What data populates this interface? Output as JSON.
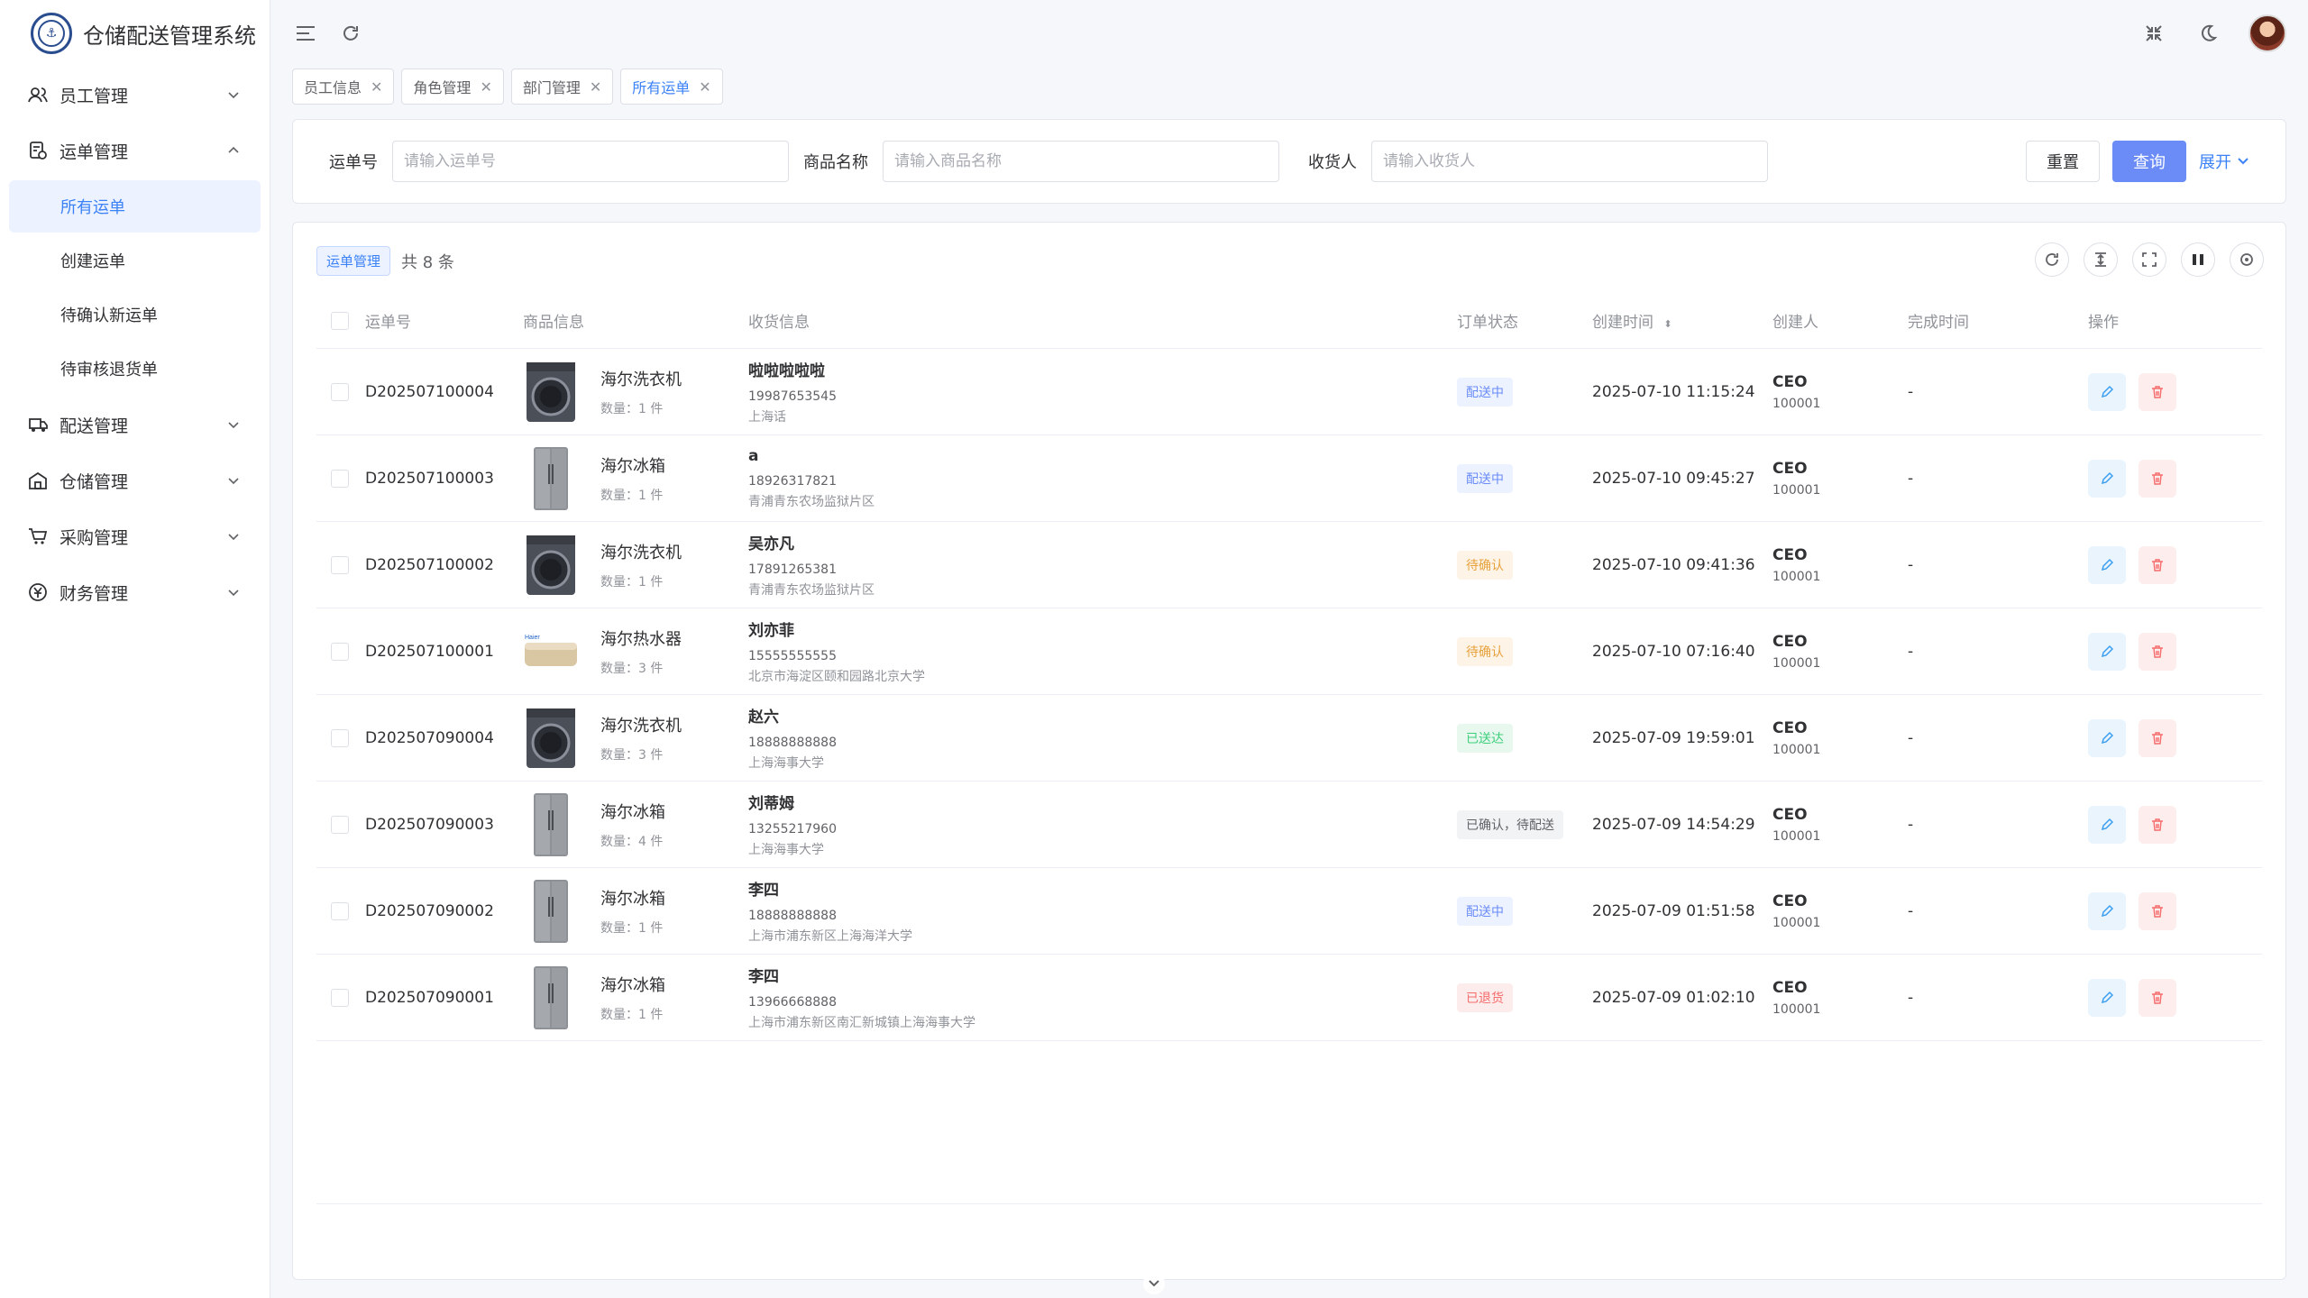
{
  "app": {
    "title": "仓储配送管理系统"
  },
  "sidebar": {
    "items": [
      {
        "label": "员工管理",
        "icon": "users-icon",
        "expanded": false
      },
      {
        "label": "运单管理",
        "icon": "waybill-icon",
        "expanded": true,
        "children": [
          {
            "label": "所有运单",
            "active": true
          },
          {
            "label": "创建运单"
          },
          {
            "label": "待确认新运单"
          },
          {
            "label": "待审核退货单"
          }
        ]
      },
      {
        "label": "配送管理",
        "icon": "truck-icon",
        "expanded": false
      },
      {
        "label": "仓储管理",
        "icon": "warehouse-icon",
        "expanded": false
      },
      {
        "label": "采购管理",
        "icon": "cart-icon",
        "expanded": false
      },
      {
        "label": "财务管理",
        "icon": "finance-icon",
        "expanded": false
      }
    ]
  },
  "tabs": [
    {
      "label": "员工信息",
      "active": false
    },
    {
      "label": "角色管理",
      "active": false
    },
    {
      "label": "部门管理",
      "active": false
    },
    {
      "label": "所有运单",
      "active": true
    }
  ],
  "search": {
    "waybill_label": "运单号",
    "waybill_placeholder": "请输入运单号",
    "goods_label": "商品名称",
    "goods_placeholder": "请输入商品名称",
    "receiver_label": "收货人",
    "receiver_placeholder": "请输入收货人",
    "reset": "重置",
    "query": "查询",
    "expand": "展开"
  },
  "table": {
    "tag": "运单管理",
    "total": "共 8 条",
    "columns": [
      "运单号",
      "商品信息",
      "收货信息",
      "订单状态",
      "创建时间",
      "创建人",
      "完成时间",
      "操作"
    ],
    "rows": [
      {
        "no": "D202507100004",
        "goods": "海尔洗衣机",
        "qty": "数量：1 件",
        "img": "washer",
        "rname": "啦啦啦啦啦",
        "rphone": "19987653545",
        "raddr": "上海话",
        "status": "配送中",
        "status_color": "blue",
        "time": "2025-07-10 11:15:24",
        "creator": "CEO",
        "creator_id": "100001",
        "done": "-"
      },
      {
        "no": "D202507100003",
        "goods": "海尔冰箱",
        "qty": "数量：1 件",
        "img": "fridge",
        "rname": "a",
        "rphone": "18926317821",
        "raddr": "青浦青东农场监狱片区",
        "status": "配送中",
        "status_color": "blue",
        "time": "2025-07-10 09:45:27",
        "creator": "CEO",
        "creator_id": "100001",
        "done": "-"
      },
      {
        "no": "D202507100002",
        "goods": "海尔洗衣机",
        "qty": "数量：1 件",
        "img": "washer",
        "rname": "吴亦凡",
        "rphone": "17891265381",
        "raddr": "青浦青东农场监狱片区",
        "status": "待确认",
        "status_color": "orange",
        "time": "2025-07-10 09:41:36",
        "creator": "CEO",
        "creator_id": "100001",
        "done": "-"
      },
      {
        "no": "D202507100001",
        "goods": "海尔热水器",
        "qty": "数量：3 件",
        "img": "heater",
        "rname": "刘亦菲",
        "rphone": "15555555555",
        "raddr": "北京市海淀区颐和园路北京大学",
        "status": "待确认",
        "status_color": "orange",
        "time": "2025-07-10 07:16:40",
        "creator": "CEO",
        "creator_id": "100001",
        "done": "-"
      },
      {
        "no": "D202507090004",
        "goods": "海尔洗衣机",
        "qty": "数量：3 件",
        "img": "washer",
        "rname": "赵六",
        "rphone": "18888888888",
        "raddr": "上海海事大学",
        "status": "已送达",
        "status_color": "green",
        "time": "2025-07-09 19:59:01",
        "creator": "CEO",
        "creator_id": "100001",
        "done": "-"
      },
      {
        "no": "D202507090003",
        "goods": "海尔冰箱",
        "qty": "数量：4 件",
        "img": "fridge",
        "rname": "刘蒂姆",
        "rphone": "13255217960",
        "raddr": "上海海事大学",
        "status": "已确认，待配送",
        "status_color": "gray",
        "time": "2025-07-09 14:54:29",
        "creator": "CEO",
        "creator_id": "100001",
        "done": "-"
      },
      {
        "no": "D202507090002",
        "goods": "海尔冰箱",
        "qty": "数量：1 件",
        "img": "fridge",
        "rname": "李四",
        "rphone": "18888888888",
        "raddr": "上海市浦东新区上海海洋大学",
        "status": "配送中",
        "status_color": "blue",
        "time": "2025-07-09 01:51:58",
        "creator": "CEO",
        "creator_id": "100001",
        "done": "-"
      },
      {
        "no": "D202507090001",
        "goods": "海尔冰箱",
        "qty": "数量：1 件",
        "img": "fridge",
        "rname": "李四",
        "rphone": "13966668888",
        "raddr": "上海市浦东新区南汇新城镇上海海事大学",
        "status": "已退货",
        "status_color": "red",
        "time": "2025-07-09 01:02:10",
        "creator": "CEO",
        "creator_id": "100001",
        "done": "-"
      }
    ]
  },
  "colors": {
    "primary": "#6b8cf7",
    "accent": "#3b82f6",
    "danger": "#f56c6c"
  }
}
